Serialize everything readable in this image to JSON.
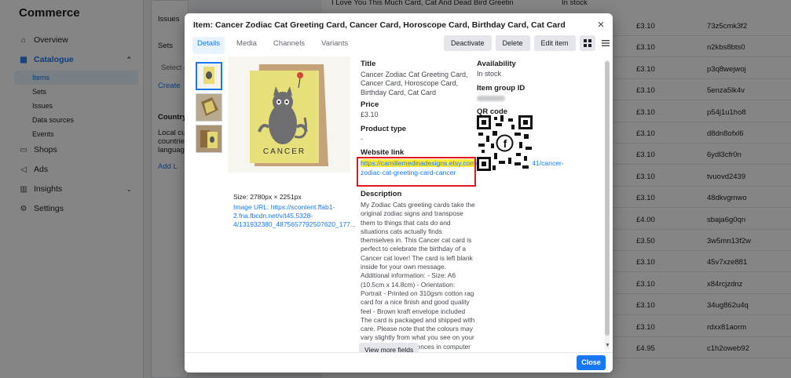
{
  "app": {
    "title": "Commerce"
  },
  "sidebar": {
    "overview": "Overview",
    "catalogue": "Catalogue",
    "catalogue_items": [
      "Items",
      "Sets",
      "Issues",
      "Data sources",
      "Events"
    ],
    "shops": "Shops",
    "ads": "Ads",
    "insights": "Insights",
    "settings": "Settings"
  },
  "background": {
    "issues_label": "Issues",
    "sets_label": "Sets",
    "select_placeholder": "Select a",
    "create_link": "Create",
    "country_title": "Country/",
    "country_text": [
      "Local curr",
      "countries,",
      "languages"
    ],
    "add_link": "Add L",
    "top_row_title": "I Love You This Much Card, Cat And Dead Bird Greetin",
    "top_row_stock": "In stock",
    "rows": [
      {
        "price": "£3.10",
        "code": "73z5cmk3f2"
      },
      {
        "price": "£3.10",
        "code": "n2kbs8bts0"
      },
      {
        "price": "£3.10",
        "code": "p3q8wejwoj"
      },
      {
        "price": "£3.10",
        "code": "5enza5lk4v"
      },
      {
        "price": "£3.10",
        "code": "p54j1u1ho8"
      },
      {
        "price": "£3.10",
        "code": "d8dn8ofxl6"
      },
      {
        "price": "£3.10",
        "code": "6ydl3cfr0n"
      },
      {
        "price": "£3.10",
        "code": "tvuovd2439"
      },
      {
        "price": "£3.10",
        "code": "48dkvgmwo"
      },
      {
        "price": "£4.00",
        "code": "sbaja6g0qn"
      },
      {
        "price": "£3.50",
        "code": "3w5mn13f2w"
      },
      {
        "price": "£3.10",
        "code": "45v7xze881"
      },
      {
        "price": "£3.10",
        "code": "x84rcjzdnz"
      },
      {
        "price": "£3.10",
        "code": "34ug862u4q"
      },
      {
        "price": "£3.10",
        "code": "rdxx81aorm"
      },
      {
        "price": "£4.95",
        "code": "c1h2oweb92"
      }
    ]
  },
  "modal": {
    "title": "Item: Cancer Zodiac Cat Greeting Card, Cancer Card, Horoscope Card, Birthday Card, Cat Card",
    "tabs": [
      "Details",
      "Media",
      "Channels",
      "Variants"
    ],
    "actions": {
      "deactivate": "Deactivate",
      "delete": "Delete",
      "edit": "Edit item"
    },
    "image": {
      "size": "Size: 2780px × 2251px",
      "url": "Image URL: https://scontent.ffab1-2.fna.fbcdn.net/v/t45.5328-4/131932380_4875657792507620_177...",
      "card_text": "CANCER"
    },
    "fields": {
      "title_label": "Title",
      "title_value": "Cancer Zodiac Cat Greeting Card, Cancer Card, Horoscope Card, Birthday Card, Cat Card",
      "price_label": "Price",
      "price_value": "£3.10",
      "product_type_label": "Product type",
      "product_type_value": "-",
      "website_label": "Website link",
      "website_highlight": "https://camillemedinadesigns.etsy.com",
      "website_rest": "/uk/listing/822382441/cancer-zodiac-cat-greeting-card-cancer",
      "description_label": "Description",
      "description_value": "My Zodiac Cats greeting cards take the original zodiac signs and transpose them to things that cats do and situations cats actually finds themselves in. This Cancer cat card is perfect to celebrate the birthday of a Cancer cat lover! The card is left blank inside for your own message. Additional information: - Size: A6 (10.5cm x 14.8cm) - Orientation: Portrait - Printed on 310gsm cotton rag card for a nice finish and good quality feel - Brown kraft envelope included The card is packaged and shipped with care. Please note that the colours may vary slightly from what you see on your screen due to differences in computer monitor settings.",
      "availability_label": "Availability",
      "availability_value": "In stock",
      "group_label": "Item group ID",
      "qr_label": "QR code"
    },
    "view_more": "View more fields",
    "close": "Close"
  }
}
